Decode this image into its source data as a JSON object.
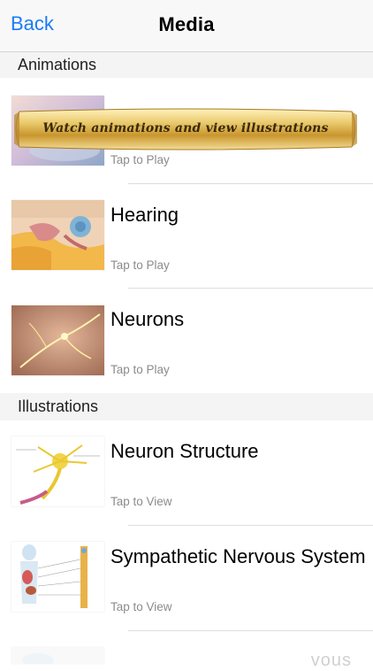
{
  "nav": {
    "back_label": "Back",
    "title": "Media"
  },
  "sections": {
    "animations": {
      "label": "Animations"
    },
    "illustrations": {
      "label": "Illustrations"
    }
  },
  "banner": {
    "text": "Watch animations and view illustrations"
  },
  "rows": [
    {
      "title": "",
      "subtitle": "Tap to Play"
    },
    {
      "title": "Hearing",
      "subtitle": "Tap to Play"
    },
    {
      "title": "Neurons",
      "subtitle": "Tap to Play"
    },
    {
      "title": "Neuron Structure",
      "subtitle": "Tap to View"
    },
    {
      "title": "Sympathetic Nervous System",
      "subtitle": "Tap to View"
    }
  ],
  "watermark": {
    "text": "vous"
  },
  "colors": {
    "accent": "#1a7cf5",
    "subtitle": "#8b8b8b",
    "section_bg": "#f4f4f4"
  }
}
